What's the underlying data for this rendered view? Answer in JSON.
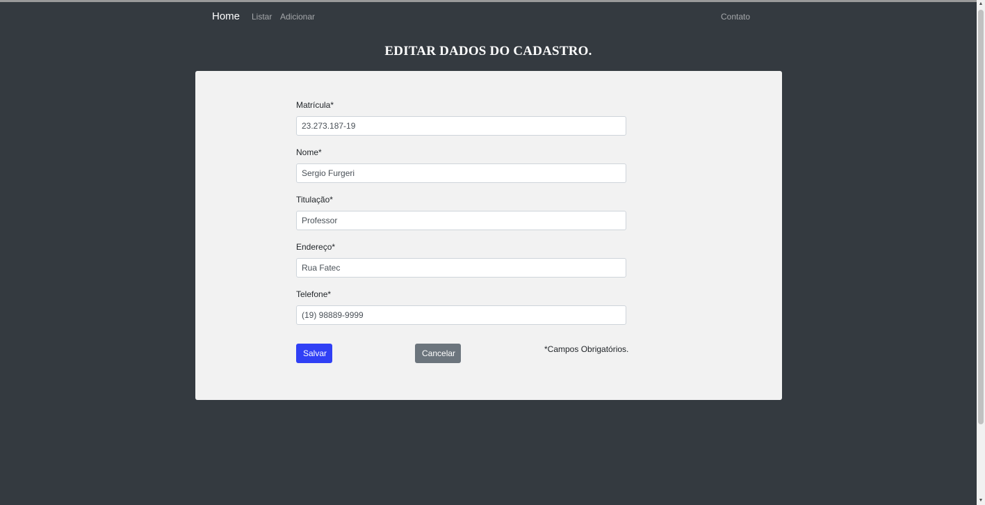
{
  "nav": {
    "brand": "Home",
    "links": [
      "Listar",
      "Adicionar"
    ],
    "contact": "Contato"
  },
  "page": {
    "title": "EDITAR DADOS DO CADASTRO."
  },
  "form": {
    "fields": [
      {
        "label": "Matrícula*",
        "value": "23.273.187-19"
      },
      {
        "label": "Nome*",
        "value": "Sergio Furgeri"
      },
      {
        "label": "Titulação*",
        "value": "Professor"
      },
      {
        "label": "Endereço*",
        "value": "Rua Fatec"
      },
      {
        "label": "Telefone*",
        "value": "(19) 98889-9999"
      }
    ],
    "save_label": "Salvar",
    "cancel_label": "Cancelar",
    "required_note": "*Campos Obrigatórios."
  },
  "colors": {
    "background": "#343a40",
    "card": "#f2f2f2",
    "primary": "#3040f5",
    "secondary": "#6c757d"
  },
  "icons": {
    "scroll_up": "scroll-up-arrow-icon",
    "scroll_down": "scroll-down-arrow-icon"
  }
}
